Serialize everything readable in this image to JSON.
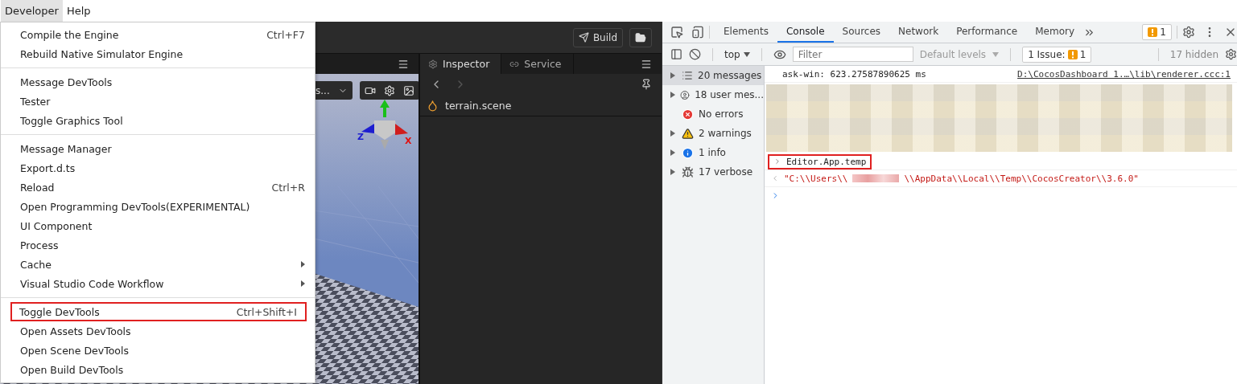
{
  "menubar": [
    {
      "label": "Developer",
      "selected": true
    },
    {
      "label": "Help",
      "selected": false
    }
  ],
  "menu": {
    "items": [
      {
        "kind": "item",
        "label": "Compile the Engine",
        "shortcut": "Ctrl+F7",
        "highlighted": false
      },
      {
        "kind": "item",
        "label": "Rebuild Native Simulator Engine",
        "highlighted": false
      },
      {
        "kind": "separator"
      },
      {
        "kind": "item",
        "label": "Message DevTools",
        "highlighted": false
      },
      {
        "kind": "item",
        "label": "Tester",
        "highlighted": false
      },
      {
        "kind": "item",
        "label": "Toggle Graphics Tool",
        "highlighted": false
      },
      {
        "kind": "separator"
      },
      {
        "kind": "item",
        "label": "Message Manager",
        "highlighted": false
      },
      {
        "kind": "item",
        "label": "Export.d.ts",
        "highlighted": false
      },
      {
        "kind": "item",
        "label": "Reload",
        "shortcut": "Ctrl+R",
        "highlighted": false
      },
      {
        "kind": "item",
        "label": "Open Programming DevTools(EXPERIMENTAL)",
        "highlighted": false
      },
      {
        "kind": "item",
        "label": "UI Component",
        "highlighted": false
      },
      {
        "kind": "item",
        "label": "Process",
        "highlighted": false
      },
      {
        "kind": "submenu",
        "label": "Cache",
        "highlighted": false
      },
      {
        "kind": "submenu",
        "label": "Visual Studio Code Workflow",
        "highlighted": false
      },
      {
        "kind": "separator"
      },
      {
        "kind": "item",
        "label": "Toggle DevTools",
        "shortcut": "Ctrl+Shift+I",
        "highlighted": true
      },
      {
        "kind": "item",
        "label": "Open Assets DevTools",
        "highlighted": false
      },
      {
        "kind": "item",
        "label": "Open Scene DevTools",
        "highlighted": false
      },
      {
        "kind": "item",
        "label": "Open Build DevTools",
        "highlighted": false
      }
    ]
  },
  "editor": {
    "build_label": "Build",
    "scene": {
      "dropdown_text": "s...",
      "gizmo_labels": [
        "Z",
        "X"
      ]
    },
    "inspector": {
      "tabs": [
        {
          "label": "Inspector",
          "selected": true
        },
        {
          "label": "Service",
          "selected": false
        }
      ],
      "asset": "terrain.scene"
    }
  },
  "devtools": {
    "tabs": [
      {
        "label": "Elements",
        "selected": false
      },
      {
        "label": "Console",
        "selected": true
      },
      {
        "label": "Sources",
        "selected": false
      },
      {
        "label": "Network",
        "selected": false
      },
      {
        "label": "Performance",
        "selected": false
      },
      {
        "label": "Memory",
        "selected": false
      }
    ],
    "issue_badge": "1",
    "context": "top",
    "filter_placeholder": "Filter",
    "levels": "Default levels",
    "issues_label": "1 Issue:",
    "issues_count": "1",
    "hidden": "17 hidden",
    "sidebar": [
      {
        "kind": "list",
        "label": "20 messages",
        "selected": true,
        "expandable": true
      },
      {
        "kind": "user",
        "label": "18 user mes...",
        "selected": false,
        "expandable": true
      },
      {
        "kind": "error",
        "label": "No errors",
        "selected": false,
        "expandable": false
      },
      {
        "kind": "warning",
        "label": "2 warnings",
        "selected": false,
        "expandable": true
      },
      {
        "kind": "info",
        "label": "1 info",
        "selected": false,
        "expandable": true
      },
      {
        "kind": "verbose",
        "label": "17 verbose",
        "selected": false,
        "expandable": true
      }
    ],
    "console": [
      {
        "kind": "log",
        "text": "ask-win: 623.27587890625 ms",
        "source": "D:\\CocosDashboard 1.…\\lib\\renderer.ccc:1"
      },
      {
        "kind": "redacted"
      },
      {
        "kind": "input",
        "text": "Editor.App.temp",
        "highlighted": true
      },
      {
        "kind": "result",
        "before": "\"C:\\\\Users\\\\",
        "after": "\\\\AppData\\\\Local\\\\Temp\\\\CocosCreator\\\\3.6.0\""
      },
      {
        "kind": "prompt"
      }
    ]
  }
}
